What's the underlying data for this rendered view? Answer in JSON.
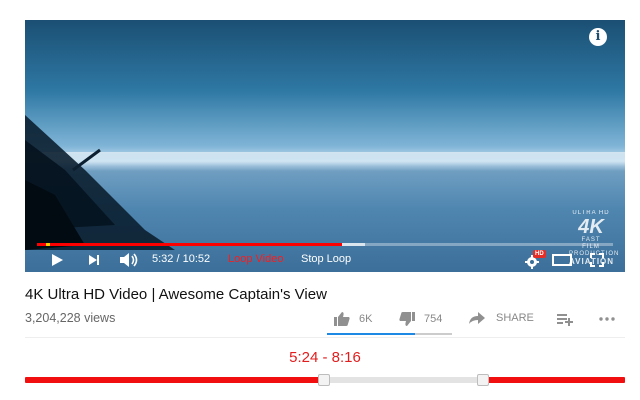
{
  "player": {
    "info_label": "i",
    "logo": {
      "big": "4K",
      "line1": "ULTRA HD",
      "line2": "FAST",
      "line3": "FILM PRODUCTION",
      "line4": "AVIATION"
    },
    "progress": {
      "played_fraction": 0.53,
      "buffered_fraction": 0.57,
      "marker_fraction": 0.015
    },
    "controls": {
      "time": "5:32 / 10:52",
      "loop_video": "Loop Video",
      "stop_loop": "Stop Loop",
      "hd_badge": "HD"
    }
  },
  "video": {
    "title": "4K Ultra HD Video | Awesome Captain's View",
    "views": "3,204,228 views"
  },
  "actions": {
    "like_count": "6K",
    "dislike_count": "754",
    "share_label": "SHARE",
    "like_ratio": 0.7
  },
  "loop_range": {
    "text": "5:24 - 8:16",
    "start_fraction": 0.497,
    "end_fraction": 0.761
  },
  "colors": {
    "accent_red": "#f20f0f",
    "like_blue": "#1e88e5",
    "loop_text_red": "#ff1a1a"
  }
}
